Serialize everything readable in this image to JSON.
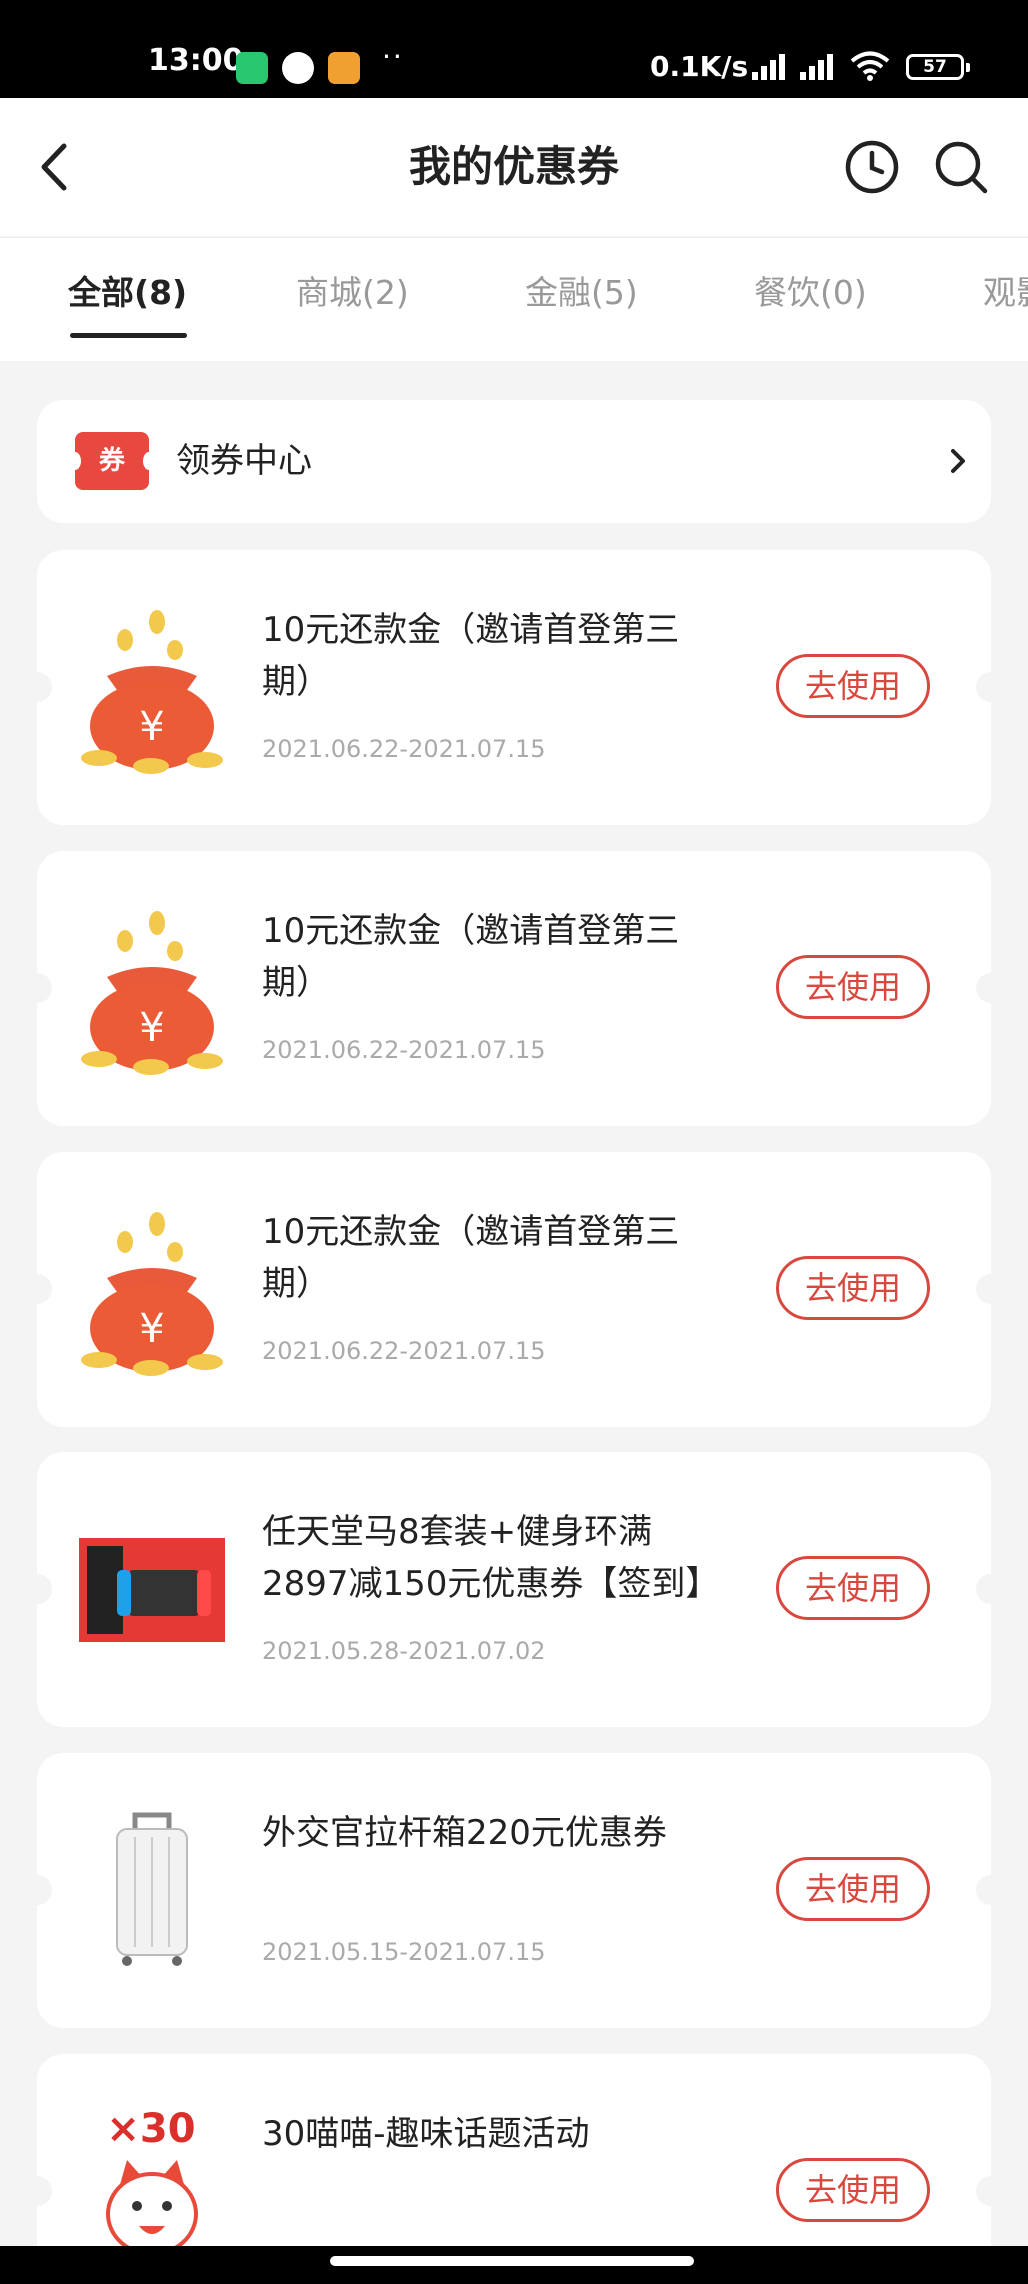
{
  "status_bar": {
    "time": "13:00",
    "dots": "··",
    "network_speed": "0.1K/s",
    "battery": "57"
  },
  "header": {
    "title": "我的优惠券",
    "back_icon": "chevron-left-icon",
    "history_icon": "clock-icon",
    "search_icon": "search-icon"
  },
  "tabs": [
    {
      "label": "全部(8)",
      "active": true
    },
    {
      "label": "商城(2)",
      "active": false
    },
    {
      "label": "金融(5)",
      "active": false
    },
    {
      "label": "餐饮(0)",
      "active": false
    },
    {
      "label": "观影",
      "active": false
    }
  ],
  "coupon_center": {
    "badge": "券",
    "label": "领券中心"
  },
  "coupons": [
    {
      "name": "10元还款金（邀请首登第三期）",
      "date": "2021.06.22-2021.07.15",
      "button": "去使用",
      "icon": "money-bag-icon"
    },
    {
      "name": "10元还款金（邀请首登第三期）",
      "date": "2021.06.22-2021.07.15",
      "button": "去使用",
      "icon": "money-bag-icon"
    },
    {
      "name": "10元还款金（邀请首登第三期）",
      "date": "2021.06.22-2021.07.15",
      "button": "去使用",
      "icon": "money-bag-icon"
    },
    {
      "name": "任天堂马8套装+健身环满2897减150元优惠券【签到】",
      "date": "2021.05.28-2021.07.02",
      "button": "去使用",
      "icon": "game-console-icon"
    },
    {
      "name": "外交官拉杆箱220元优惠券",
      "date": "2021.05.15-2021.07.15",
      "button": "去使用",
      "icon": "suitcase-icon"
    },
    {
      "name": "30喵喵-趣味话题活动",
      "date": "",
      "button": "去使用",
      "icon": "cat-icon",
      "badge_text": "×30"
    }
  ],
  "colors": {
    "accent": "#d9483f",
    "badge": "#e8483f",
    "background": "#f4f4f4"
  }
}
